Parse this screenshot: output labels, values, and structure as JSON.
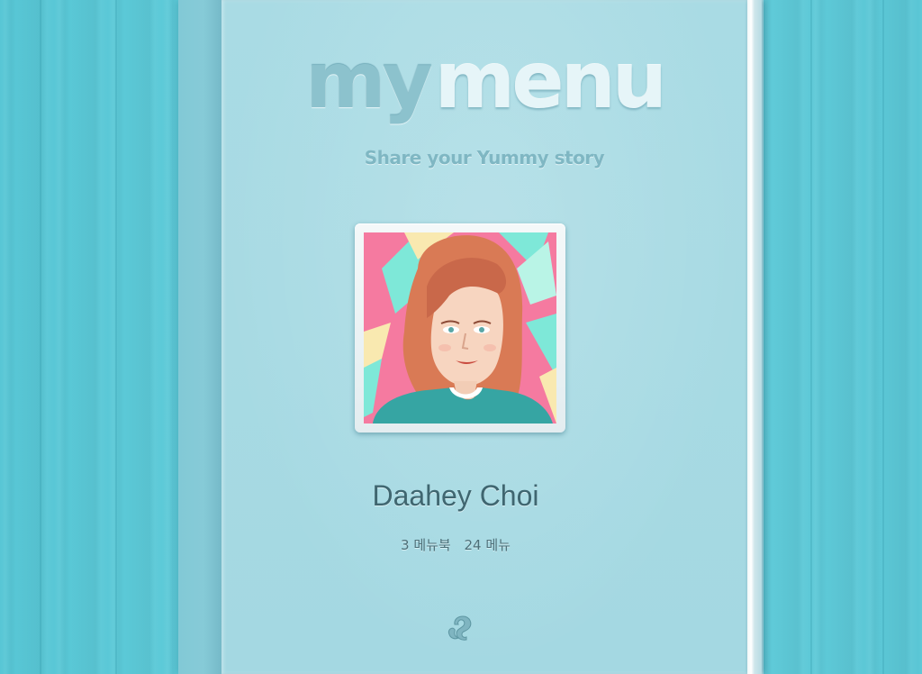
{
  "cover": {
    "logo_my": "my",
    "logo_menu": "menu",
    "tagline": "Share your Yummy story"
  },
  "profile": {
    "name": "Daahey Choi",
    "menubook_count": "3 메뉴북",
    "menu_count": "24 메뉴",
    "avatar_icon": "profile-portrait-illustration"
  },
  "footer": {
    "icon": "squirrel-logo-icon"
  },
  "colors": {
    "background_wood": "#5bc8d6",
    "cover": "#a7dae3",
    "name_text": "#3f6670",
    "photo_accent_pink": "#f57aa0",
    "photo_accent_mint": "#7ee8d8"
  }
}
